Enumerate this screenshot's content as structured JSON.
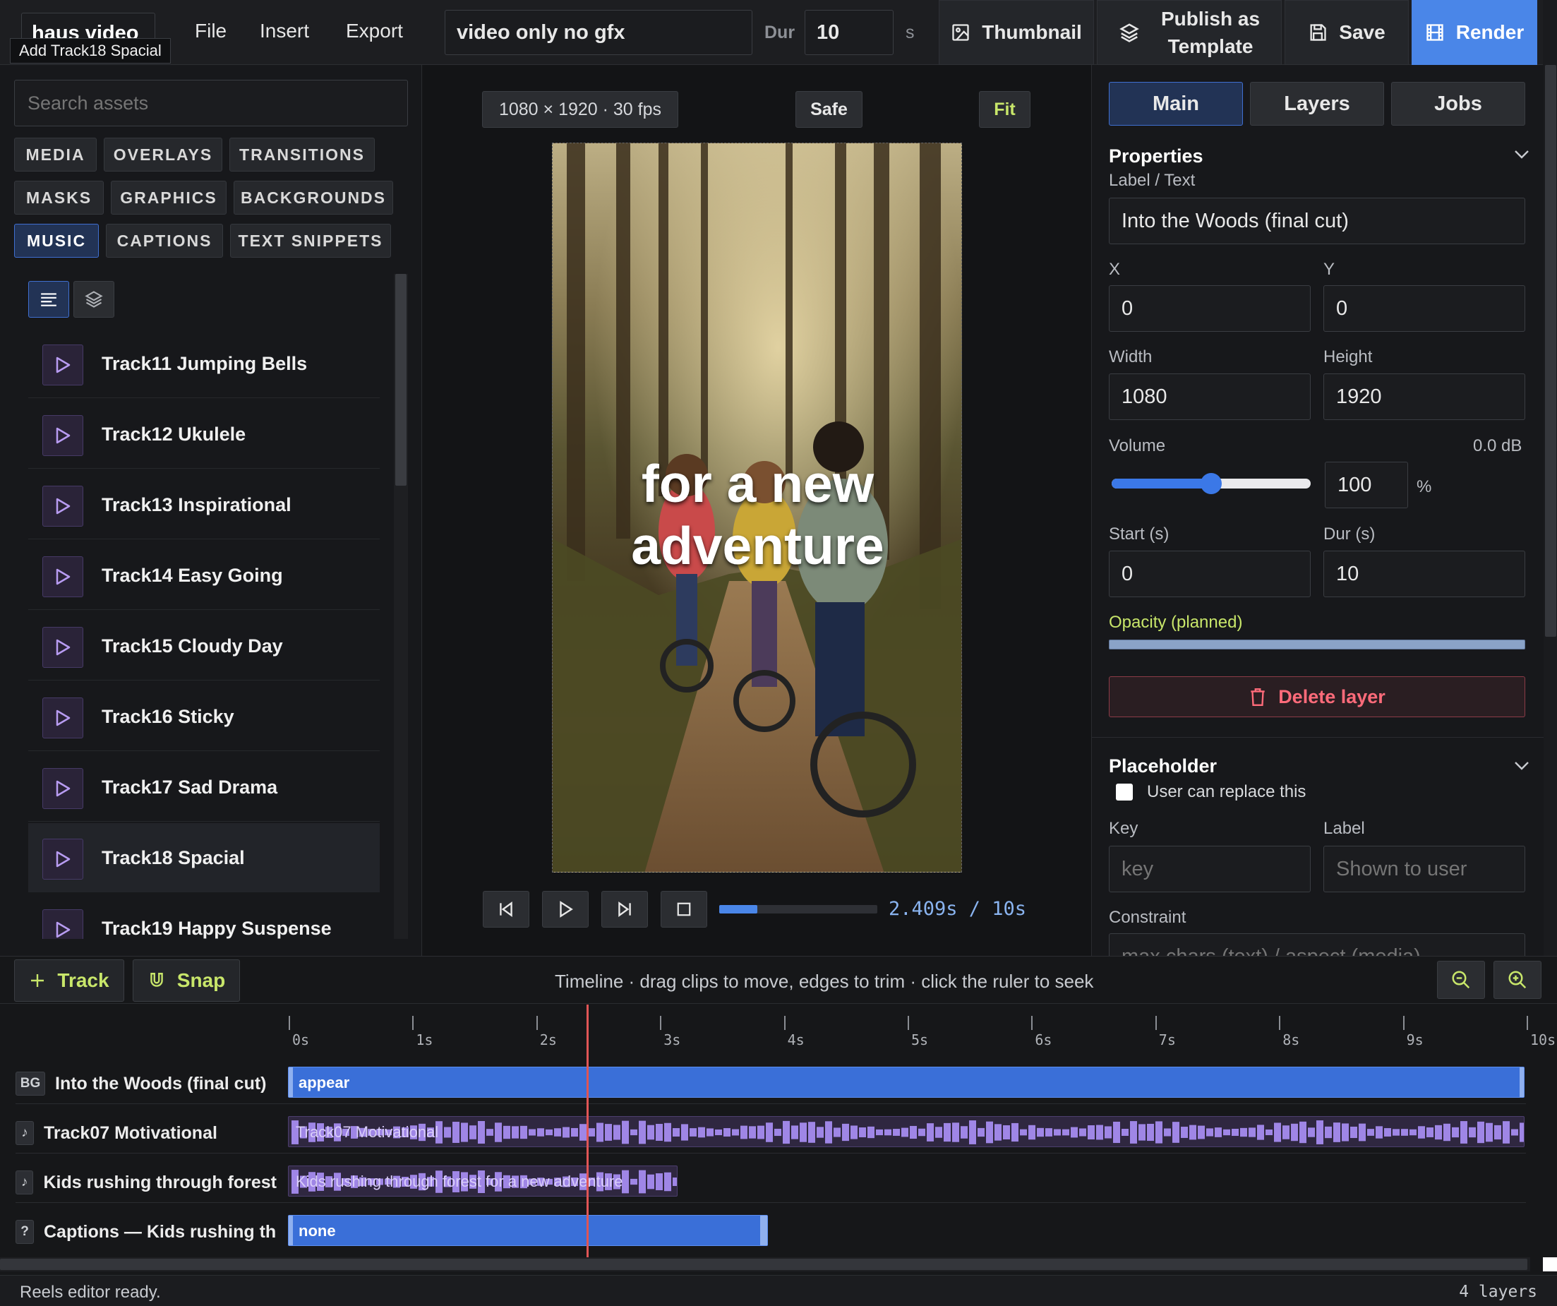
{
  "app": {
    "logo": "haus video",
    "tooltip": "Add Track18 Spacial"
  },
  "menu": {
    "file": "File",
    "insert": "Insert",
    "export": "Export"
  },
  "project": {
    "name": "video only no gfx",
    "dur_label": "Dur",
    "dur_value": "10",
    "dur_unit": "s"
  },
  "toolbar": {
    "thumbnail": "Thumbnail",
    "publish_line1": "Publish as",
    "publish_line2": "Template",
    "save": "Save",
    "render": "Render"
  },
  "assets": {
    "search_placeholder": "Search assets",
    "categories": [
      "MEDIA",
      "OVERLAYS",
      "TRANSITIONS",
      "MASKS",
      "GRAPHICS",
      "BACKGROUNDS",
      "MUSIC",
      "CAPTIONS",
      "TEXT SNIPPETS"
    ],
    "active_category": "MUSIC",
    "tracks": [
      "Track11 Jumping Bells",
      "Track12 Ukulele",
      "Track13 Inspirational",
      "Track14 Easy Going",
      "Track15 Cloudy Day",
      "Track16 Sticky",
      "Track17 Sad Drama",
      "Track18 Spacial",
      "Track19 Happy Suspense"
    ],
    "selected_track": "Track18 Spacial"
  },
  "preview": {
    "resolution": "1080 × 1920 · 30 fps",
    "safe": "Safe",
    "fit": "Fit",
    "caption_line1": "for a new",
    "caption_line2": "adventure",
    "time": "2.409s / 10s",
    "progress": 0.2409
  },
  "inspector": {
    "tabs": [
      "Main",
      "Layers",
      "Jobs"
    ],
    "active_tab": "Main",
    "properties_title": "Properties",
    "label_text_label": "Label / Text",
    "label_text_value": "Into the Woods (final cut)",
    "x_label": "X",
    "x_value": "0",
    "y_label": "Y",
    "y_value": "0",
    "width_label": "Width",
    "width_value": "1080",
    "height_label": "Height",
    "height_value": "1920",
    "volume_label": "Volume",
    "volume_db": "0.0 dB",
    "volume_value": "100",
    "volume_unit": "%",
    "volume_level": 0.5,
    "start_label": "Start (s)",
    "start_value": "0",
    "dur_label": "Dur (s)",
    "dur_value": "10",
    "opacity_label": "Opacity (planned)",
    "delete_label": "Delete layer",
    "placeholder_title": "Placeholder",
    "replace_label": "User can replace this",
    "key_label": "Key",
    "key_placeholder": "key",
    "label_label": "Label",
    "label_placeholder": "Shown to user",
    "constraint_label": "Constraint",
    "constraint_placeholder": "max chars (text) / aspect (media)"
  },
  "timeline": {
    "add_track": "Track",
    "snap": "Snap",
    "hint": "Timeline · drag clips to move, edges to trim · click the ruler to seek",
    "ticks": [
      "0s",
      "1s",
      "2s",
      "3s",
      "4s",
      "5s",
      "6s",
      "7s",
      "8s",
      "9s",
      "10s"
    ],
    "playhead_seconds": 2.409,
    "rows": [
      {
        "badge": "BG",
        "name": "Into the Woods (final cut)",
        "clip_label": "appear"
      },
      {
        "badge": "♪",
        "name": "Track07 Motivational",
        "clip_label": "Track07 Motivational"
      },
      {
        "badge": "♪",
        "name": "Kids rushing through forest",
        "clip_label": "Kids rushing through forest for a new adventure"
      },
      {
        "badge": "?",
        "name": "Captions — Kids rushing th",
        "clip_label": "none"
      }
    ]
  },
  "status": {
    "text": "Reels editor ready.",
    "layers": "4 layers"
  },
  "colors": {
    "accent": "#4a86e8",
    "lime": "#c8e66a",
    "danger": "#ff6b7a",
    "clip_blue": "#3a6fd8",
    "audio_purple": "#9f86e6",
    "playhead": "#e05555"
  }
}
